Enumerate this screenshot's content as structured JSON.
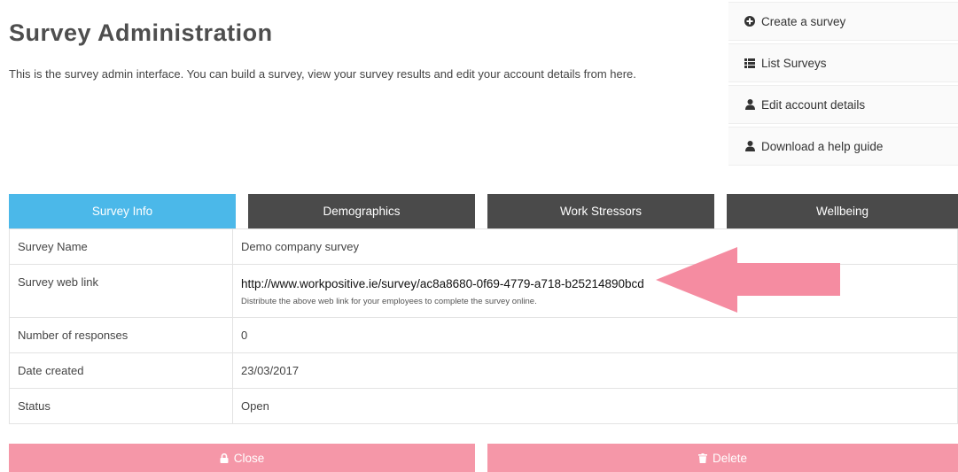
{
  "header": {
    "title": "Survey Administration",
    "description": "This is the survey admin interface. You can build a survey, view your survey results and edit your account details from here."
  },
  "side_menu": [
    {
      "label": "Create a survey",
      "icon": "plus-circle-icon"
    },
    {
      "label": "List Surveys",
      "icon": "list-icon"
    },
    {
      "label": "Edit account details",
      "icon": "user-icon"
    },
    {
      "label": "Download a help guide",
      "icon": "user-icon"
    }
  ],
  "tabs": [
    {
      "label": "Survey Info",
      "active": true
    },
    {
      "label": "Demographics",
      "active": false
    },
    {
      "label": "Work Stressors",
      "active": false
    },
    {
      "label": "Wellbeing",
      "active": false
    }
  ],
  "info_table": {
    "survey_name": {
      "label": "Survey Name",
      "value": "Demo company survey"
    },
    "web_link": {
      "label": "Survey web link",
      "value": "http://www.workpositive.ie/survey/ac8a8680-0f69-4779-a718-b25214890bcd",
      "hint": "Distribute the above web link for your employees to complete the survey online."
    },
    "responses": {
      "label": "Number of responses",
      "value": "0"
    },
    "date_created": {
      "label": "Date created",
      "value": "23/03/2017"
    },
    "status": {
      "label": "Status",
      "value": "Open"
    }
  },
  "actions": {
    "close_label": "Close",
    "delete_label": "Delete"
  },
  "colors": {
    "active_tab": "#4bb8e9",
    "inactive_tab": "#4a4a4a",
    "action_button": "#f597a8",
    "arrow": "#f58ca1"
  }
}
